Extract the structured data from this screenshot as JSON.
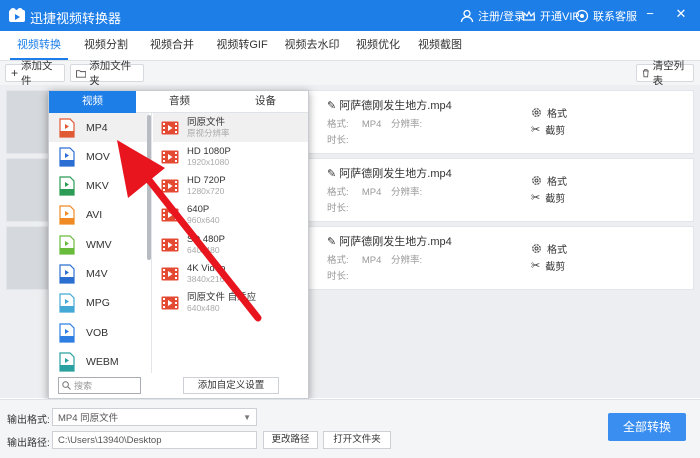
{
  "app": {
    "title": "迅捷视频转换器"
  },
  "titlebar": {
    "login": "注册/登录",
    "vip": "开通VIP",
    "support": "联系客服"
  },
  "tabs": [
    "视频转换",
    "视频分割",
    "视频合并",
    "视频转GIF",
    "视频去水印",
    "视频优化",
    "视频截图"
  ],
  "toolbar": {
    "add_file": "添加文件",
    "add_folder": "添加文件夹",
    "clear_list": "清空列表"
  },
  "files": [
    {
      "name": "阿萨德刚发生地方.mp4",
      "format_label": "格式:",
      "format": "MP4",
      "resolution_label": "分辨率:",
      "duration_label": "时长:",
      "format_btn": "格式",
      "cut_btn": "截剪"
    },
    {
      "name": "阿萨德刚发生地方.mp4",
      "format_label": "格式:",
      "format": "MP4",
      "resolution_label": "分辨率:",
      "duration_label": "时长:",
      "format_btn": "格式",
      "cut_btn": "截剪"
    },
    {
      "name": "阿萨德刚发生地方.mp4",
      "format_label": "格式:",
      "format": "MP4",
      "resolution_label": "分辨率:",
      "duration_label": "时长:",
      "format_btn": "格式",
      "cut_btn": "截剪"
    }
  ],
  "popup": {
    "tabs": [
      "视频",
      "音频",
      "设备"
    ],
    "formats": [
      {
        "label": "MP4",
        "color": "#e05a36"
      },
      {
        "label": "MOV",
        "color": "#2a6ed4"
      },
      {
        "label": "MKV",
        "color": "#2c9b55"
      },
      {
        "label": "AVI",
        "color": "#f08a24"
      },
      {
        "label": "WMV",
        "color": "#69bb3c"
      },
      {
        "label": "M4V",
        "color": "#2b6fd1"
      },
      {
        "label": "MPG",
        "color": "#45a9d6"
      },
      {
        "label": "VOB",
        "color": "#2f7fe2"
      },
      {
        "label": "WEBM",
        "color": "#2aa0a0"
      }
    ],
    "resolutions": [
      {
        "name": "同原文件",
        "sub": "原视分辨率"
      },
      {
        "name": "HD 1080P",
        "sub": "1920x1080"
      },
      {
        "name": "HD 720P",
        "sub": "1280x720"
      },
      {
        "name": "640P",
        "sub": "960x640"
      },
      {
        "name": "SD 480P",
        "sub": "640x480"
      },
      {
        "name": "4K Video",
        "sub": "3840x2160"
      },
      {
        "name": "同原文件 自适应",
        "sub": "640x480"
      }
    ],
    "search_placeholder": "搜索",
    "custom_btn": "添加自定义设置"
  },
  "bottom": {
    "output_format_label": "输出格式:",
    "output_format_value": "MP4  同原文件",
    "output_path_label": "输出路径:",
    "output_path_value": "C:\\Users\\13940\\Desktop",
    "change_path": "更改路径",
    "open_folder": "打开文件夹",
    "convert_all": "全部转换"
  },
  "colors": {
    "accent": "#1e7ee8",
    "annotation_arrow": "#e8141e"
  }
}
